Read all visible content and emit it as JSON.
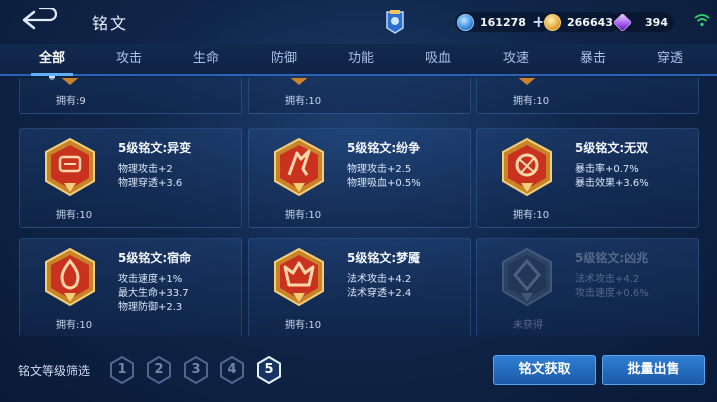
{
  "header": {
    "title": "铭文",
    "currencies": [
      {
        "name": "diamond",
        "icon": "diamond-icon",
        "value": "161278",
        "color": "#5fb6ff"
      },
      {
        "name": "gold",
        "icon": "gold-coin-icon",
        "value": "266643",
        "color": "#e8b24a"
      },
      {
        "name": "crystal",
        "icon": "crystal-icon",
        "value": "394",
        "color": "#b56cff"
      }
    ]
  },
  "tabs": [
    "全部",
    "攻击",
    "生命",
    "防御",
    "功能",
    "吸血",
    "攻速",
    "暴击",
    "穿透"
  ],
  "active_tab": "全部",
  "partial_cards": [
    {
      "owned": "拥有:9"
    },
    {
      "owned": "拥有:10"
    },
    {
      "owned": "拥有:10"
    }
  ],
  "cards": [
    {
      "name": "5级铭文:异变",
      "attrs": [
        "物理攻击+2",
        "物理穿透+3.6"
      ],
      "owned": "拥有:10",
      "icon": "mutation-rune-icon"
    },
    {
      "name": "5级铭文:纷争",
      "attrs": [
        "物理攻击+2.5",
        "物理吸血+0.5%"
      ],
      "owned": "拥有:10",
      "icon": "strife-rune-icon"
    },
    {
      "name": "5级铭文:无双",
      "attrs": [
        "暴击率+0.7%",
        "暴击效果+3.6%"
      ],
      "owned": "拥有:10",
      "icon": "peerless-rune-icon"
    },
    {
      "name": "5级铭文:宿命",
      "attrs": [
        "攻击速度+1%",
        "最大生命+33.7",
        "物理防御+2.3"
      ],
      "owned": "拥有:10",
      "icon": "fate-rune-icon"
    },
    {
      "name": "5级铭文:梦魇",
      "attrs": [
        "法术攻击+4.2",
        "法术穿透+2.4"
      ],
      "owned": "拥有:10",
      "icon": "nightmare-rune-icon"
    },
    {
      "name": "5级铭文:凶兆",
      "attrs": [
        "法术攻击+4.2",
        "攻击速度+0.6%"
      ],
      "owned": "未获得",
      "icon": "omen-rune-icon",
      "locked": true
    }
  ],
  "footer": {
    "filter_label": "铭文等级筛选",
    "levels": [
      "1",
      "2",
      "3",
      "4",
      "5"
    ],
    "active_level": "5",
    "acquire_button": "铭文获取",
    "sell_button": "批量出售"
  },
  "colors": {
    "accent": "#5fb2ff",
    "rune_gold": "#d9a441",
    "rune_red": "#c9321f"
  }
}
